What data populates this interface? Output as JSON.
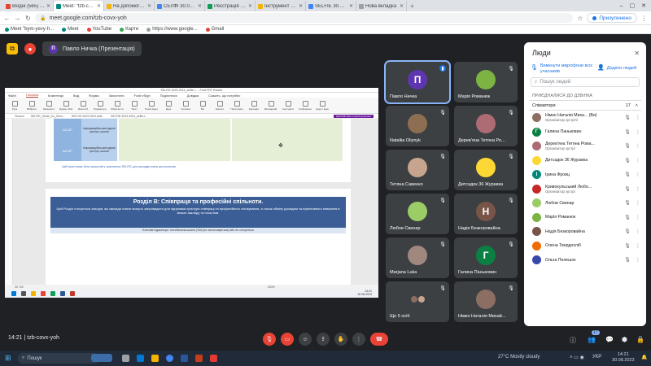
{
  "browser": {
    "tabs": [
      {
        "label": "Вхідні (565) - n.nimko@ippo.ed",
        "color": "#ea4335",
        "active": false
      },
      {
        "label": "Meet: \"tzb-covx-yoh\"",
        "color": "#00897b",
        "active": true
      },
      {
        "label": "На допомогу вчителю інформ",
        "color": "#f4b400",
        "active": false
      },
      {
        "label": "СЕЛФІ 30.08.2023 – Google Дис",
        "color": "#4285f4",
        "active": false
      },
      {
        "label": "Реєстрація на семінар «Викор",
        "color": "#0f9d58",
        "active": false
      },
      {
        "label": "Інструмент SELFIE 30.08.2023",
        "color": "#f4b400",
        "active": false
      },
      {
        "label": "SELFIE 30.08.2023 – Mentimeter",
        "color": "#4285f4",
        "active": false
      },
      {
        "label": "Нова вкладка",
        "color": "#9aa0a6",
        "active": false
      }
    ],
    "url": "meet.google.com/tzb-covx-yoh",
    "profile_label": "Призупинено",
    "bookmarks": [
      "Meet \"bym-yevy-h...",
      "Meet",
      "YouTube",
      "Карти",
      "https://www.google...",
      "Gmail"
    ]
  },
  "meet": {
    "presentation_label": "Павло Ничка (Презентація)",
    "presenter_initial": "П",
    "meeting_code": "tzb-covx-yoh",
    "time": "14:21",
    "presenting_badge": "Edit PDF files in word processor"
  },
  "pdf": {
    "window_title": "SELFIE-2023-2024_selfie-l... - Foxit PDF Reader",
    "menu": [
      "Файл",
      "Головна",
      "Коментарі",
      "Вид",
      "Форма",
      "Захистити",
      "Foxit eSign",
      "Поділитися",
      "Довідка",
      "Скажіть, що потрібно"
    ],
    "tools": [
      "Рука",
      "Вибрати",
      "Зменшити",
      "Буфер обміну",
      "Масштаб",
      "Параметри подання сторінок",
      "Обертає подання",
      "Текст",
      "Показ відео",
      "Друк",
      "Читання",
      "Всі",
      "Змінити",
      "Посилання",
      "Закладки",
      "Вкладений файл",
      "Анотувати",
      "Ізображення",
      "Аудіо і відео"
    ],
    "doc_tabs": [
      "Почати",
      "SELFIE_Guide_for_Scho...",
      "SELFIE-2023-2024-selfi...",
      "SELFIE-2023-2024_selfie-l..."
    ],
    "table_rows": [
      {
        "code": "A1-DP",
        "text": "Інформаційно-методичні центри, школи"
      },
      {
        "code": "A2-DP",
        "text": "Інформаційно-методичні центри, школи"
      }
    ],
    "table_note": "Цей пункт може бути присутній у запитаннях SELFIE для закладів освіти для вчителів.",
    "section_title": "Розділ В: Співпраця та професійні спільноти.",
    "section_text": "Цей Розділ стосується заходів, які заклади освіти можуть запровадити для підтримки культури співпраці та професійного спілкування, а також обміну досвідом та ефективного навчання в межах закладу та поза ним.",
    "section_note": "Ключові індикатори: п'ятибальна шкала | N/A (не застосовується) або не стосується",
    "status_page": "20 / 60",
    "status_zoom": "100%",
    "win_time": "14:21",
    "win_date": "30.08.2023"
  },
  "tiles": [
    {
      "name": "Павло Ничка",
      "initial": "П",
      "color": "#5e35b1",
      "speaking": true
    },
    {
      "name": "Марія Романюк",
      "initial": "",
      "color": "#7cb342",
      "speaking": false
    },
    {
      "name": "Nataliia Oliynyk",
      "initial": "",
      "color": "#8e6e53",
      "speaking": false
    },
    {
      "name": "Дерев'яна Тетяна Ро...",
      "initial": "",
      "color": "#ad6b74",
      "speaking": false
    },
    {
      "name": "Тетяна Савенко",
      "initial": "",
      "color": "#c7a48e",
      "speaking": false
    },
    {
      "name": "Дитсадок 36 Журавка",
      "initial": "",
      "color": "#fdd835",
      "speaking": false
    },
    {
      "name": "Любов Свинар",
      "initial": "",
      "color": "#9ccc65",
      "speaking": false
    },
    {
      "name": "Надія Безкоровайна",
      "initial": "Н",
      "color": "#795548",
      "speaking": false
    },
    {
      "name": "Marjana Luka",
      "initial": "",
      "color": "#a1887f",
      "speaking": false
    },
    {
      "name": "Галина Паньковин",
      "initial": "Г",
      "color": "#0b8043",
      "speaking": false
    },
    {
      "name": "Ще 5 осіб",
      "initial": "",
      "color": "#5f6368",
      "speaking": false
    },
    {
      "name": "Німко Наталія Михай...",
      "initial": "",
      "color": "#8d6e63",
      "speaking": false
    }
  ],
  "people_panel": {
    "title": "Люди",
    "mute_all_label": "Вимкнути мікрофони всіх учасників",
    "add_people_label": "Додати людей",
    "search_placeholder": "Пошук людей",
    "section_label": "ПРИЄДНАЛИСЯ ДО ДЗВІНКА",
    "group_label": "Співавтори",
    "group_count": "17",
    "members": [
      {
        "name": "Німко Наталія Миха... (Ви)",
        "role": "Організатор зустрічі",
        "initial": "",
        "color": "#8d6e63"
      },
      {
        "name": "Галина Паньковин",
        "role": "",
        "initial": "Г",
        "color": "#0b8043"
      },
      {
        "name": "Дерев'яна Тетяна Рома...",
        "role": "Організатор зустрі",
        "initial": "",
        "color": "#ad6b74"
      },
      {
        "name": "Дитсадок 36 Журавка",
        "role": "",
        "initial": "",
        "color": "#fdd835"
      },
      {
        "name": "Ірина Фроиц",
        "role": "",
        "initial": "І",
        "color": "#00897b"
      },
      {
        "name": "Кривокульський Любо...",
        "role": "Організатор зустрі",
        "initial": "",
        "color": "#c62828"
      },
      {
        "name": "Любов Свинар",
        "role": "",
        "initial": "",
        "color": "#9ccc65"
      },
      {
        "name": "Марія Романюк",
        "role": "",
        "initial": "",
        "color": "#7cb342"
      },
      {
        "name": "Надія Безкоровайна",
        "role": "",
        "initial": "",
        "color": "#795548"
      },
      {
        "name": "Олена Твердохліб",
        "role": "",
        "initial": "",
        "color": "#ef6c00"
      },
      {
        "name": "Ольга Пелешок",
        "role": "",
        "initial": "",
        "color": "#3949ab"
      }
    ]
  },
  "bottom_bar": {
    "participant_count": "17"
  },
  "os_taskbar": {
    "search_label": "Пошук",
    "weather": "27°C  Mostly cloudy",
    "lang": "УКР",
    "time": "14:21",
    "date": "30.08.2023"
  }
}
